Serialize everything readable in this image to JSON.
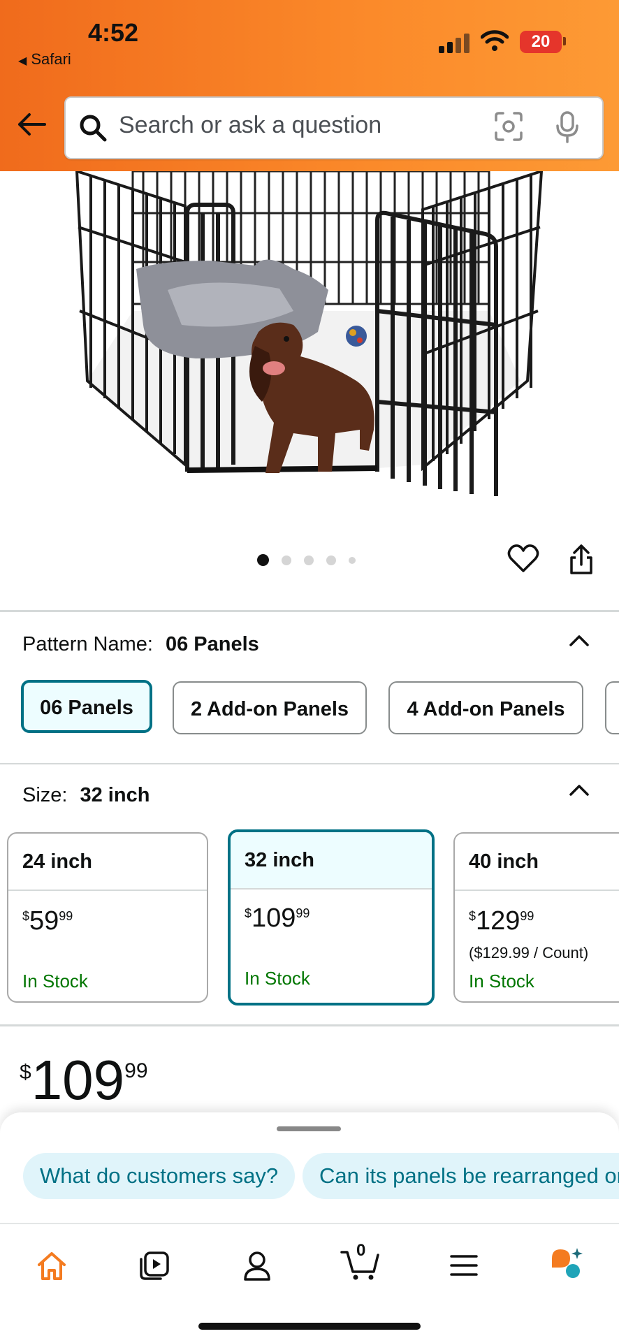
{
  "status_bar": {
    "time": "4:52",
    "back_app": "Safari",
    "battery": "20"
  },
  "search": {
    "placeholder": "Search or ask a question"
  },
  "carousel": {
    "pages": 5,
    "current": 1
  },
  "pattern": {
    "label": "Pattern Name:",
    "selected": "06 Panels",
    "options": [
      "06 Panels",
      "2 Add-on Panels",
      "4 Add-on Panels"
    ]
  },
  "size": {
    "label": "Size:",
    "selected": "32 inch",
    "options": [
      {
        "name": "24 inch",
        "dollars": "59",
        "cents": "99",
        "unit_price": "",
        "stock": "In Stock"
      },
      {
        "name": "32 inch",
        "dollars": "109",
        "cents": "99",
        "unit_price": "",
        "stock": "In Stock"
      },
      {
        "name": "40 inch",
        "dollars": "129",
        "cents": "99",
        "unit_price": "($129.99 / Count)",
        "stock": "In Stock"
      }
    ]
  },
  "price": {
    "symbol": "$",
    "dollars": "109",
    "cents": "99"
  },
  "suggestions": [
    "What do customers say?",
    "Can its panels be rearranged or"
  ],
  "tabbar": {
    "cart_count": "0",
    "tabs": [
      "home",
      "video",
      "account",
      "cart",
      "menu",
      "rufus"
    ]
  },
  "colors": {
    "accent_orange": "#f47b20",
    "teal": "#007185",
    "in_stock_green": "#007600"
  }
}
